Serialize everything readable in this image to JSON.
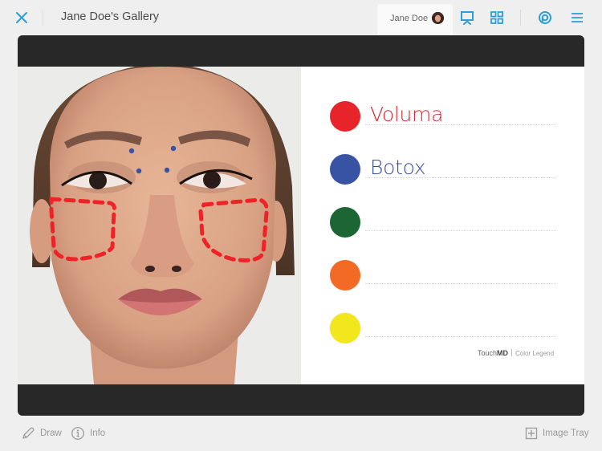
{
  "header": {
    "title": "Jane Doe's Gallery",
    "user_name": "Jane Doe",
    "icons": {
      "close": "close-icon",
      "presentation": "presentation-icon",
      "grid": "grid-icon",
      "chat": "chat-icon",
      "menu": "hamburger-menu-icon"
    },
    "accent_color": "#2a9fd8"
  },
  "viewer": {
    "photo_description": "Front-facing portrait with treatment markings",
    "markings": {
      "blue_injection_points": 4,
      "red_dashed_regions": 2
    },
    "legend": {
      "items": [
        {
          "color": "#e8242b",
          "label": "Voluma"
        },
        {
          "color": "#3953a4",
          "label": "Botox"
        },
        {
          "color": "#1b6632",
          "label": ""
        },
        {
          "color": "#f26a24",
          "label": ""
        },
        {
          "color": "#f2e61c",
          "label": ""
        }
      ],
      "brand_light": "Touch",
      "brand_bold": "MD",
      "subtitle": "Color Legend"
    }
  },
  "footer": {
    "draw_label": "Draw",
    "info_label": "Info",
    "image_tray_label": "Image Tray"
  }
}
